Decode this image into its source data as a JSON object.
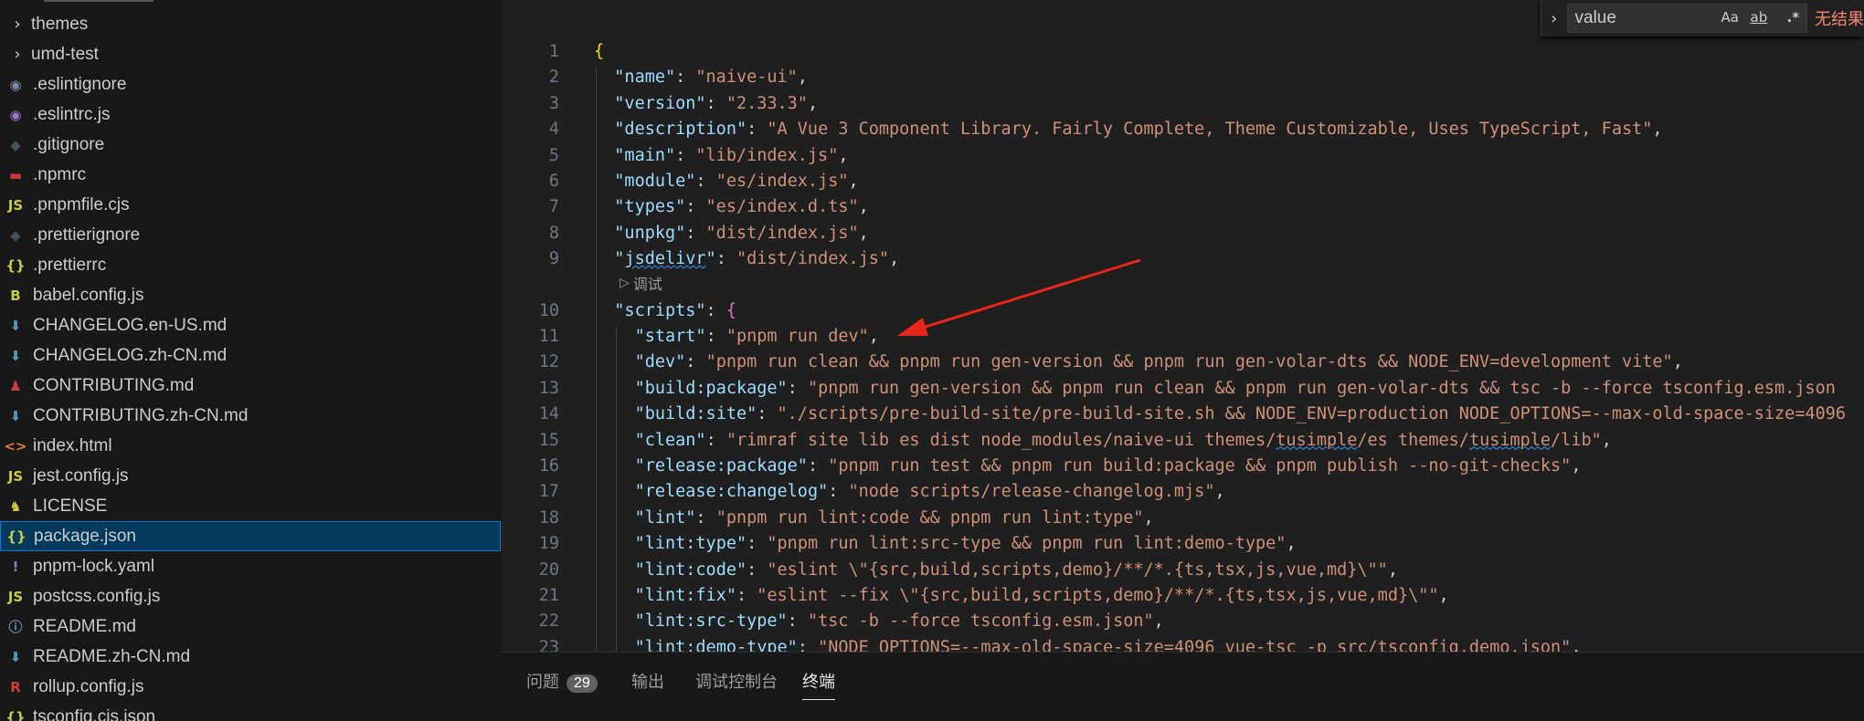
{
  "sidebar": {
    "items": [
      {
        "label": "themes",
        "icon": "chevron-right-icon",
        "kind": "folder"
      },
      {
        "label": "umd-test",
        "icon": "chevron-right-icon",
        "kind": "folder"
      },
      {
        "label": ".eslintignore",
        "icon": "eslint-icon",
        "glyph": "◉",
        "color": "#7c8fa6"
      },
      {
        "label": ".eslintrc.js",
        "icon": "eslint-icon",
        "glyph": "◉",
        "color": "#a074c4"
      },
      {
        "label": ".gitignore",
        "icon": "git-icon",
        "glyph": "◆",
        "color": "#41535b"
      },
      {
        "label": ".npmrc",
        "icon": "npm-icon",
        "glyph": "▬",
        "color": "#cb3837"
      },
      {
        "label": ".pnpmfile.cjs",
        "icon": "js-icon",
        "glyph": "JS",
        "color": "#cbcb41"
      },
      {
        "label": ".prettierignore",
        "icon": "prettier-icon",
        "glyph": "◆",
        "color": "#41535b"
      },
      {
        "label": ".prettierrc",
        "icon": "json-icon",
        "glyph": "{}",
        "color": "#cbcb41"
      },
      {
        "label": "babel.config.js",
        "icon": "babel-icon",
        "glyph": "B",
        "color": "#cbcb41"
      },
      {
        "label": "CHANGELOG.en-US.md",
        "icon": "markdown-icon",
        "glyph": "⬇",
        "color": "#519aba"
      },
      {
        "label": "CHANGELOG.zh-CN.md",
        "icon": "markdown-icon",
        "glyph": "⬇",
        "color": "#519aba"
      },
      {
        "label": "CONTRIBUTING.md",
        "icon": "contributing-icon",
        "glyph": "♟",
        "color": "#cc3e44"
      },
      {
        "label": "CONTRIBUTING.zh-CN.md",
        "icon": "markdown-icon",
        "glyph": "⬇",
        "color": "#519aba"
      },
      {
        "label": "index.html",
        "icon": "html-icon",
        "glyph": "<>",
        "color": "#e37933"
      },
      {
        "label": "jest.config.js",
        "icon": "js-icon",
        "glyph": "JS",
        "color": "#cbcb41"
      },
      {
        "label": "LICENSE",
        "icon": "license-icon",
        "glyph": "♞",
        "color": "#cbcb41"
      },
      {
        "label": "package.json",
        "icon": "json-icon",
        "glyph": "{}",
        "color": "#cbcb41",
        "selected": true
      },
      {
        "label": "pnpm-lock.yaml",
        "icon": "yaml-icon",
        "glyph": "!",
        "color": "#a074c4"
      },
      {
        "label": "postcss.config.js",
        "icon": "js-icon",
        "glyph": "JS",
        "color": "#cbcb41"
      },
      {
        "label": "README.md",
        "icon": "info-icon",
        "glyph": "ⓘ",
        "color": "#519aba"
      },
      {
        "label": "README.zh-CN.md",
        "icon": "markdown-icon",
        "glyph": "⬇",
        "color": "#519aba"
      },
      {
        "label": "rollup.config.js",
        "icon": "rollup-icon",
        "glyph": "R",
        "color": "#cc3e44"
      },
      {
        "label": "tsconfig.cjs.json",
        "icon": "json-icon",
        "glyph": "{}",
        "color": "#cbcb41"
      }
    ]
  },
  "find": {
    "value": "value",
    "match_case": "Aa",
    "whole_word": "ab",
    "regex": ".*",
    "result": "无结果"
  },
  "editor": {
    "codelens": "调试",
    "lines": [
      {
        "n": "1",
        "indent": 0,
        "parts": [
          [
            "b1",
            "{"
          ]
        ]
      },
      {
        "n": "2",
        "indent": 1,
        "parts": [
          [
            "k",
            "\"name\""
          ],
          [
            "p",
            ": "
          ],
          [
            "s",
            "\"naive-ui\""
          ],
          [
            "p",
            ","
          ]
        ]
      },
      {
        "n": "3",
        "indent": 1,
        "parts": [
          [
            "k",
            "\"version\""
          ],
          [
            "p",
            ": "
          ],
          [
            "s",
            "\"2.33.3\""
          ],
          [
            "p",
            ","
          ]
        ]
      },
      {
        "n": "4",
        "indent": 1,
        "parts": [
          [
            "k",
            "\"description\""
          ],
          [
            "p",
            ": "
          ],
          [
            "s",
            "\"A Vue 3 Component Library. Fairly Complete, Theme Customizable, Uses TypeScript, Fast\""
          ],
          [
            "p",
            ","
          ]
        ]
      },
      {
        "n": "5",
        "indent": 1,
        "parts": [
          [
            "k",
            "\"main\""
          ],
          [
            "p",
            ": "
          ],
          [
            "s",
            "\"lib/index.js\""
          ],
          [
            "p",
            ","
          ]
        ]
      },
      {
        "n": "6",
        "indent": 1,
        "parts": [
          [
            "k",
            "\"module\""
          ],
          [
            "p",
            ": "
          ],
          [
            "s",
            "\"es/index.js\""
          ],
          [
            "p",
            ","
          ]
        ]
      },
      {
        "n": "7",
        "indent": 1,
        "parts": [
          [
            "k",
            "\"types\""
          ],
          [
            "p",
            ": "
          ],
          [
            "s",
            "\"es/index.d.ts\""
          ],
          [
            "p",
            ","
          ]
        ]
      },
      {
        "n": "8",
        "indent": 1,
        "parts": [
          [
            "k",
            "\"unpkg\""
          ],
          [
            "p",
            ": "
          ],
          [
            "s",
            "\"dist/index.js\""
          ],
          [
            "p",
            ","
          ]
        ]
      },
      {
        "n": "9",
        "indent": 1,
        "parts": [
          [
            "k",
            "\""
          ],
          [
            "k squig",
            "jsdelivr"
          ],
          [
            "k",
            "\""
          ],
          [
            "p",
            ": "
          ],
          [
            "s",
            "\"dist/index.js\""
          ],
          [
            "p",
            ","
          ]
        ]
      },
      {
        "n": "10",
        "indent": 1,
        "parts": [
          [
            "k",
            "\"scripts\""
          ],
          [
            "p",
            ": "
          ],
          [
            "b2",
            "{"
          ]
        ]
      },
      {
        "n": "11",
        "indent": 2,
        "parts": [
          [
            "k",
            "\"start\""
          ],
          [
            "p",
            ": "
          ],
          [
            "s",
            "\"pnpm run dev\""
          ],
          [
            "p",
            ","
          ]
        ]
      },
      {
        "n": "12",
        "indent": 2,
        "parts": [
          [
            "k",
            "\"dev\""
          ],
          [
            "p",
            ": "
          ],
          [
            "s",
            "\"pnpm run clean && pnpm run gen-version && pnpm run gen-volar-dts && NODE_ENV=development vite\""
          ],
          [
            "p",
            ","
          ]
        ]
      },
      {
        "n": "13",
        "indent": 2,
        "parts": [
          [
            "k",
            "\"build:package\""
          ],
          [
            "p",
            ": "
          ],
          [
            "s",
            "\"pnpm run gen-version && pnpm run clean && pnpm run gen-volar-dts && tsc -b --force tsconfig.esm.json"
          ]
        ]
      },
      {
        "n": "14",
        "indent": 2,
        "parts": [
          [
            "k",
            "\"build:site\""
          ],
          [
            "p",
            ": "
          ],
          [
            "s",
            "\"./scripts/pre-build-site/pre-build-site.sh && NODE_ENV=production NODE_OPTIONS=--max-old-space-size=4096"
          ]
        ]
      },
      {
        "n": "15",
        "indent": 2,
        "parts": [
          [
            "k",
            "\"clean\""
          ],
          [
            "p",
            ": "
          ],
          [
            "s",
            "\"rimraf site lib es dist node_modules/naive-ui themes/"
          ],
          [
            "s squig",
            "tusimple"
          ],
          [
            "s",
            "/es themes/"
          ],
          [
            "s squig",
            "tusimple"
          ],
          [
            "s",
            "/lib\""
          ],
          [
            "p",
            ","
          ]
        ]
      },
      {
        "n": "16",
        "indent": 2,
        "parts": [
          [
            "k",
            "\"release:package\""
          ],
          [
            "p",
            ": "
          ],
          [
            "s",
            "\"pnpm run test && pnpm run build:package && pnpm publish --no-git-checks\""
          ],
          [
            "p",
            ","
          ]
        ]
      },
      {
        "n": "17",
        "indent": 2,
        "parts": [
          [
            "k",
            "\"release:changelog\""
          ],
          [
            "p",
            ": "
          ],
          [
            "s",
            "\"node scripts/release-changelog.mjs\""
          ],
          [
            "p",
            ","
          ]
        ]
      },
      {
        "n": "18",
        "indent": 2,
        "parts": [
          [
            "k",
            "\"lint\""
          ],
          [
            "p",
            ": "
          ],
          [
            "s",
            "\"pnpm run lint:code && pnpm run lint:type\""
          ],
          [
            "p",
            ","
          ]
        ]
      },
      {
        "n": "19",
        "indent": 2,
        "parts": [
          [
            "k",
            "\"lint:type\""
          ],
          [
            "p",
            ": "
          ],
          [
            "s",
            "\"pnpm run lint:src-type && pnpm run lint:demo-type\""
          ],
          [
            "p",
            ","
          ]
        ]
      },
      {
        "n": "20",
        "indent": 2,
        "parts": [
          [
            "k",
            "\"lint:code\""
          ],
          [
            "p",
            ": "
          ],
          [
            "s",
            "\"eslint \\\"{src,build,scripts,demo}/**/*.{ts,tsx,js,vue,md}\\\"\""
          ],
          [
            "p",
            ","
          ]
        ]
      },
      {
        "n": "21",
        "indent": 2,
        "parts": [
          [
            "k",
            "\"lint:fix\""
          ],
          [
            "p",
            ": "
          ],
          [
            "s",
            "\"eslint --fix \\\"{src,build,scripts,demo}/**/*.{ts,tsx,js,vue,md}\\\"\""
          ],
          [
            "p",
            ","
          ]
        ]
      },
      {
        "n": "22",
        "indent": 2,
        "parts": [
          [
            "k",
            "\"lint:src-type\""
          ],
          [
            "p",
            ": "
          ],
          [
            "s",
            "\"tsc -b --force tsconfig.esm.json\""
          ],
          [
            "p",
            ","
          ]
        ]
      },
      {
        "n": "23",
        "indent": 2,
        "parts": [
          [
            "k",
            "\"lint:demo-type\""
          ],
          [
            "p",
            ": "
          ],
          [
            "s",
            "\"NODE_OPTIONS=--max-old-space-size=4096 vue-tsc -p src/tsconfig.demo.json\""
          ],
          [
            "p",
            ","
          ]
        ]
      }
    ]
  },
  "panel": {
    "tabs": [
      {
        "label": "问题",
        "badge": "29"
      },
      {
        "label": "输出"
      },
      {
        "label": "调试控制台"
      },
      {
        "label": "终端",
        "active": true
      }
    ]
  },
  "colors": {
    "annotation_arrow": "#e8261c",
    "selection": "#04395e",
    "key": "#9cdcfe",
    "string": "#ce9178"
  }
}
